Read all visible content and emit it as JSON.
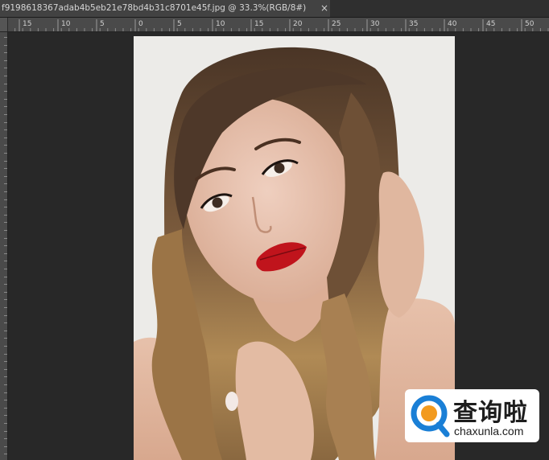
{
  "document_tab": {
    "title": "f9198618367adab4b5eb21e78bd4b31c8701e45f.jpg @ 33.3%(RGB/8#)",
    "close_symbol": "×"
  },
  "ruler": {
    "labels": [
      "15",
      "10",
      "5",
      "0",
      "5",
      "10",
      "15",
      "20",
      "25",
      "30",
      "35",
      "40",
      "45",
      "50"
    ]
  },
  "watermark": {
    "brand_cn": "查询啦",
    "url": "chaxunla.com",
    "logo_icon": "search-magnifier-logo-icon",
    "colors": {
      "blue": "#1a7fd6",
      "orange": "#f29a1e"
    }
  },
  "colors": {
    "workspace": "#282828",
    "tab_bg": "#424242",
    "ruler_bg": "#4a4a4a",
    "photo_bg": "#ecebe8",
    "lips": "#c0141c"
  }
}
